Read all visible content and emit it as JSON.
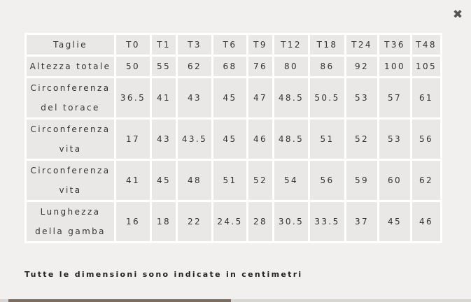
{
  "modal": {
    "close_icon": "close-icon",
    "close_glyph": "✖",
    "note": "Tutte le dimensioni sono indicate in centimetri"
  },
  "table": {
    "header": [
      "Taglie",
      "T0",
      "T1",
      "T3",
      "T6",
      "T9",
      "T12",
      "T18",
      "T24",
      "T36",
      "T48"
    ],
    "rows": [
      {
        "label": "Altezza totale",
        "values": [
          "50",
          "55",
          "62",
          "68",
          "76",
          "80",
          "86",
          "92",
          "100",
          "105"
        ]
      },
      {
        "label": "Circonferenza del torace",
        "values": [
          "36.5",
          "41",
          "43",
          "45",
          "47",
          "48.5",
          "50.5",
          "53",
          "57",
          "61"
        ]
      },
      {
        "label": "Circonferenza vita",
        "values": [
          "17",
          "43",
          "43.5",
          "45",
          "46",
          "48.5",
          "51",
          "52",
          "53",
          "56"
        ]
      },
      {
        "label": "Circonferenza vita",
        "values": [
          "41",
          "45",
          "48",
          "51",
          "52",
          "54",
          "56",
          "59",
          "60",
          "62"
        ]
      },
      {
        "label": "Lunghezza della gamba",
        "values": [
          "16",
          "18",
          "22",
          "24.5",
          "28",
          "30.5",
          "33.5",
          "37",
          "45",
          "46"
        ]
      }
    ]
  }
}
